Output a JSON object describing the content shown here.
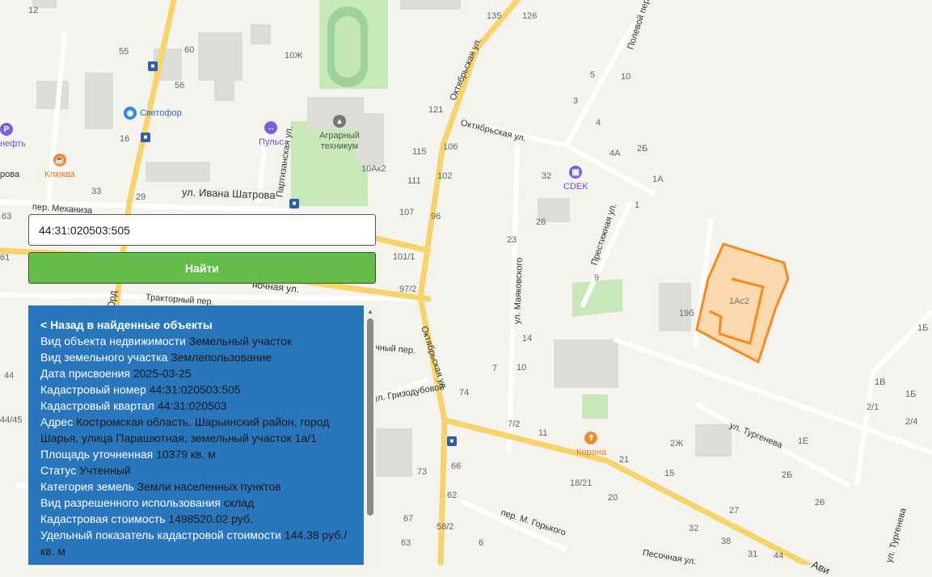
{
  "search": {
    "value": "44:31:020503:505"
  },
  "find_button": {
    "label": "Найти"
  },
  "info": {
    "back_link": "< Назад в найденные объекты",
    "rows": [
      {
        "key": "Вид объекта недвижимости",
        "value": "Земельный участок"
      },
      {
        "key": "Вид земельного участка",
        "value": "Землепользование"
      },
      {
        "key": "Дата присвоения",
        "value": "2025-03-25"
      },
      {
        "key": "Кадастровый номер",
        "value": "44:31:020503:505"
      },
      {
        "key": "Кадастровый квартал",
        "value": "44:31:020503"
      },
      {
        "key": "Адрес",
        "value": "Костромская область, Шарьинский район, город Шарья, улица Парашютная, земельный участок 1а/1"
      },
      {
        "key": "Площадь уточненная",
        "value": "10379 кв. м"
      },
      {
        "key": "Статус",
        "value": "Учтенный"
      },
      {
        "key": "Категория земель",
        "value": "Земли населенных пунктов"
      },
      {
        "key": "Вид разрешенного использования",
        "value": "склад"
      },
      {
        "key": "Кадастровая стоимость",
        "value": "1498520.02 руб."
      },
      {
        "key": "Удельный показатель кадастровой стоимости",
        "value": "144.38 руб./кв. м"
      }
    ]
  },
  "map": {
    "streets": {
      "oktyabrskaya_1": "Октябрьская ул.",
      "oktyabrskaya_2": "Октябрьская ул.",
      "oktyabrskaya_3": "Октябрьская ул.",
      "ivana_shatrova": "ул. Ивана Шатрова",
      "partizanskaya": "Партизанская ул.",
      "mehanizatorov": "пер. Механиза",
      "traktorny": "Тракторный пер.",
      "mayakovskogo": "ул. Маяковского",
      "prestizhnaya": "Престижная ул.",
      "polevoy": "Полевой пер.",
      "turgeneva": "ул. Тургенева",
      "turgeneva_2": "ул. Тургенева",
      "grizodubovoy": "ул. Гризодубовой",
      "m_gorkogo": "пер. М. Горького",
      "pesochnaya": "Песочная ул.",
      "ord": "Орд",
      "nochnaya": "ночная ул.",
      "chny_per": "чный пер.",
      "avi": "Ави",
      "rova": "рова"
    },
    "pois": {
      "svetofor": "Светофор",
      "puls": "Пульс",
      "agrarny": "Аграрный техникум",
      "klyukva": "Клюква",
      "neft": "нефть",
      "cdek": "CDEK",
      "korona": "Корона"
    },
    "parcel_label": "1Ас2",
    "house_numbers": [
      "12",
      "55",
      "60",
      "56",
      "16",
      "33",
      "29",
      "63",
      "61",
      "10Ж",
      "10Ак2",
      "107",
      "101/1",
      "97/2",
      "135",
      "126",
      "121",
      "115",
      "106",
      "111",
      "102",
      "96",
      "32",
      "28",
      "23",
      "14",
      "10",
      "7",
      "74",
      "7/2",
      "11",
      "66",
      "73",
      "62",
      "67",
      "58/2",
      "63",
      "6",
      "9",
      "5",
      "3",
      "4",
      "10",
      "4А",
      "2Б",
      "1А",
      "1",
      "19б",
      "1Б",
      "1В",
      "2/1",
      "1Б",
      "2/4",
      "1Е",
      "2Ж",
      "21",
      "15",
      "20",
      "27",
      "32",
      "38",
      "31",
      "44",
      "18/21",
      "26",
      "2Б",
      "44",
      "44/45",
      "ровa"
    ]
  },
  "colors": {
    "panel_bg": "#2a76bd",
    "button_bg": "#66be4a",
    "parcel_stroke": "#f58a1f",
    "parcel_fill": "#fbd8ad",
    "road_major": "#f6d36b"
  }
}
